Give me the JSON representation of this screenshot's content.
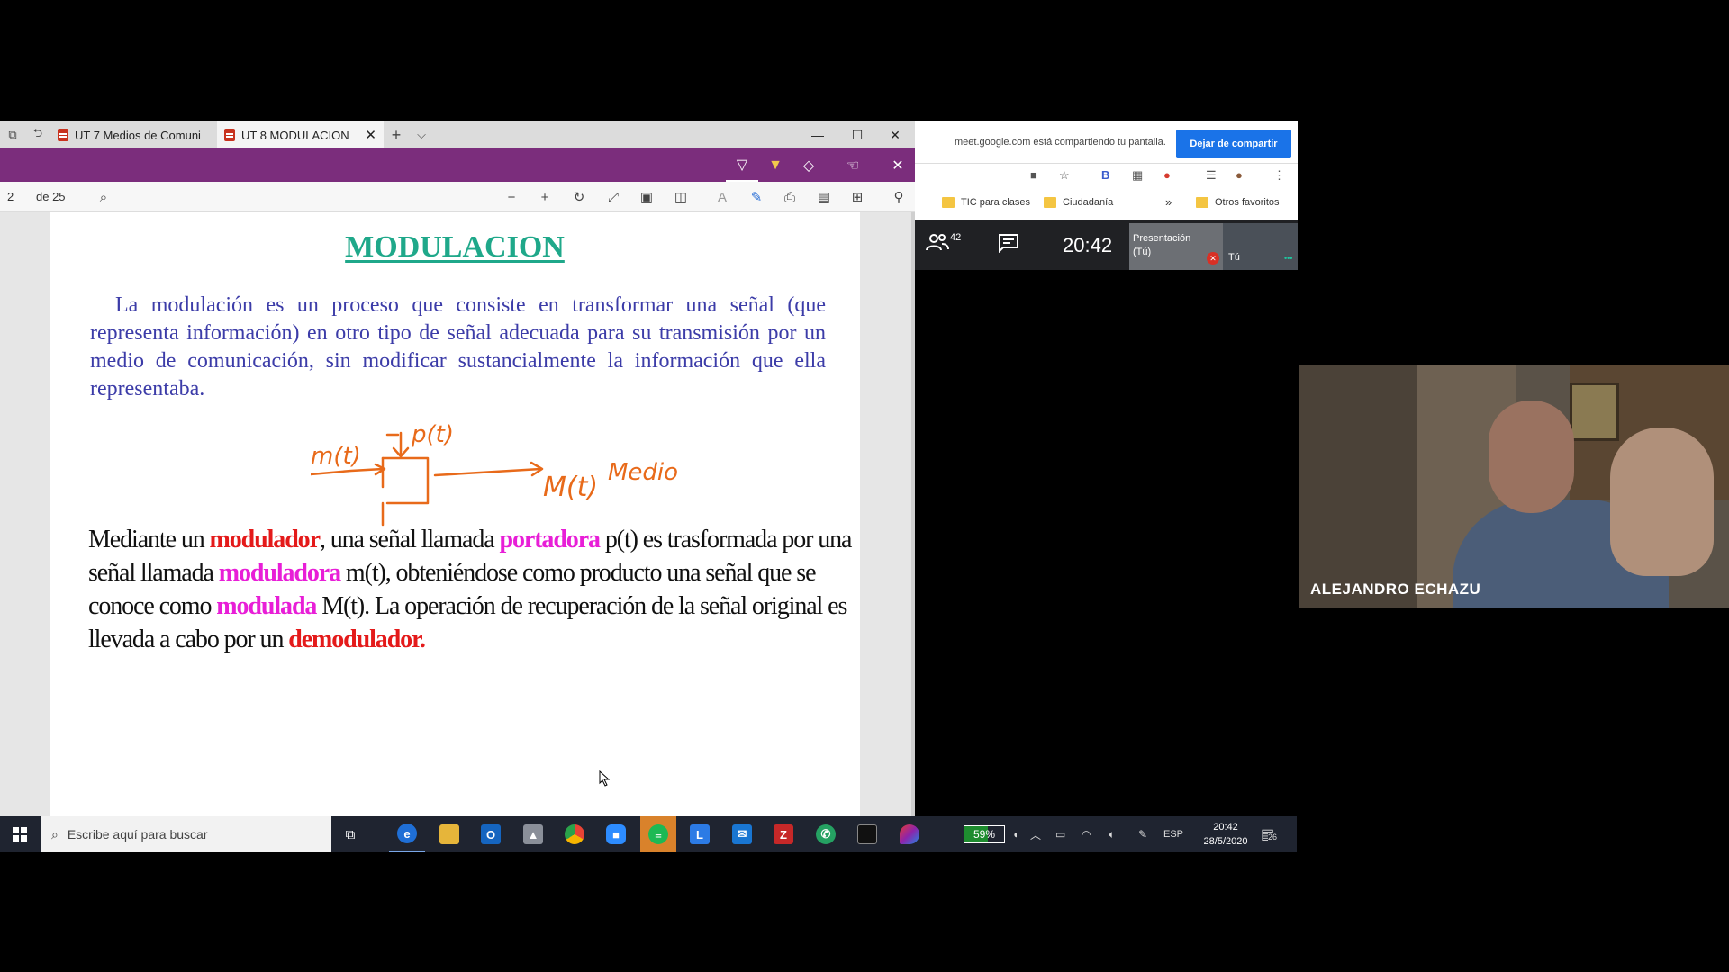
{
  "browser": {
    "tabs": [
      {
        "label": "UT 7 Medios de Comuni"
      },
      {
        "label": "UT 8 MODULACION",
        "active": true
      }
    ]
  },
  "pdf_toolbar": {
    "page_current": "2",
    "page_total": "de 25"
  },
  "pdf": {
    "title": "MODULACION",
    "paragraph1": "La modulación es un proceso que consiste en transformar una señal (que representa información) en otro tipo de señal adecuada para su transmisión por un medio de comunicación, sin modificar sustancialmente la información que ella representaba.",
    "p2_part1": "Mediante un ",
    "p2_modulador": "modulador",
    "p2_part2": ", una señal llamada ",
    "p2_portadora": "portadora",
    "p2_part3": " p(t) es trasformada por una señal llamada ",
    "p2_moduladora": "moduladora",
    "p2_part4": " m(t), obteniéndose como producto una señal que se conoce como ",
    "p2_modulada": "modulada",
    "p2_part5": " M(t). La operación de recuperación de la señal original es llevada a cabo por un ",
    "p2_demodulador": "demodulador",
    "p2_part6": ".",
    "handwriting": {
      "input": "m(t)",
      "carrier": "p(t)",
      "output": "M(t)",
      "medium": "Medio"
    }
  },
  "meet": {
    "share_message": "meet.google.com está compartiendo tu pantalla.",
    "stop_share_label": "Dejar de compartir",
    "bookmarks": [
      "TIC para clases",
      "Ciudadanía",
      "Otros favoritos"
    ],
    "bookmarks_more": "»",
    "participants_count": "42",
    "clock": "20:42",
    "presentation_label": "Presentación (Tú)",
    "self_label": "Tú"
  },
  "video": {
    "participant_name": "ALEJANDRO ECHAZU"
  },
  "taskbar": {
    "search_placeholder": "Escribe aquí para buscar",
    "battery": "59%",
    "language": "ESP",
    "time": "20:42",
    "date": "28/5/2020",
    "notifications": "26"
  },
  "colors": {
    "title": "#1fa88a",
    "paragraph": "#3c3ca8",
    "red_terms": "#e41a1a",
    "magenta_terms": "#e81ed7",
    "ink_toolbar": "#7b2d7c",
    "handwriting": "#e86a1a"
  }
}
